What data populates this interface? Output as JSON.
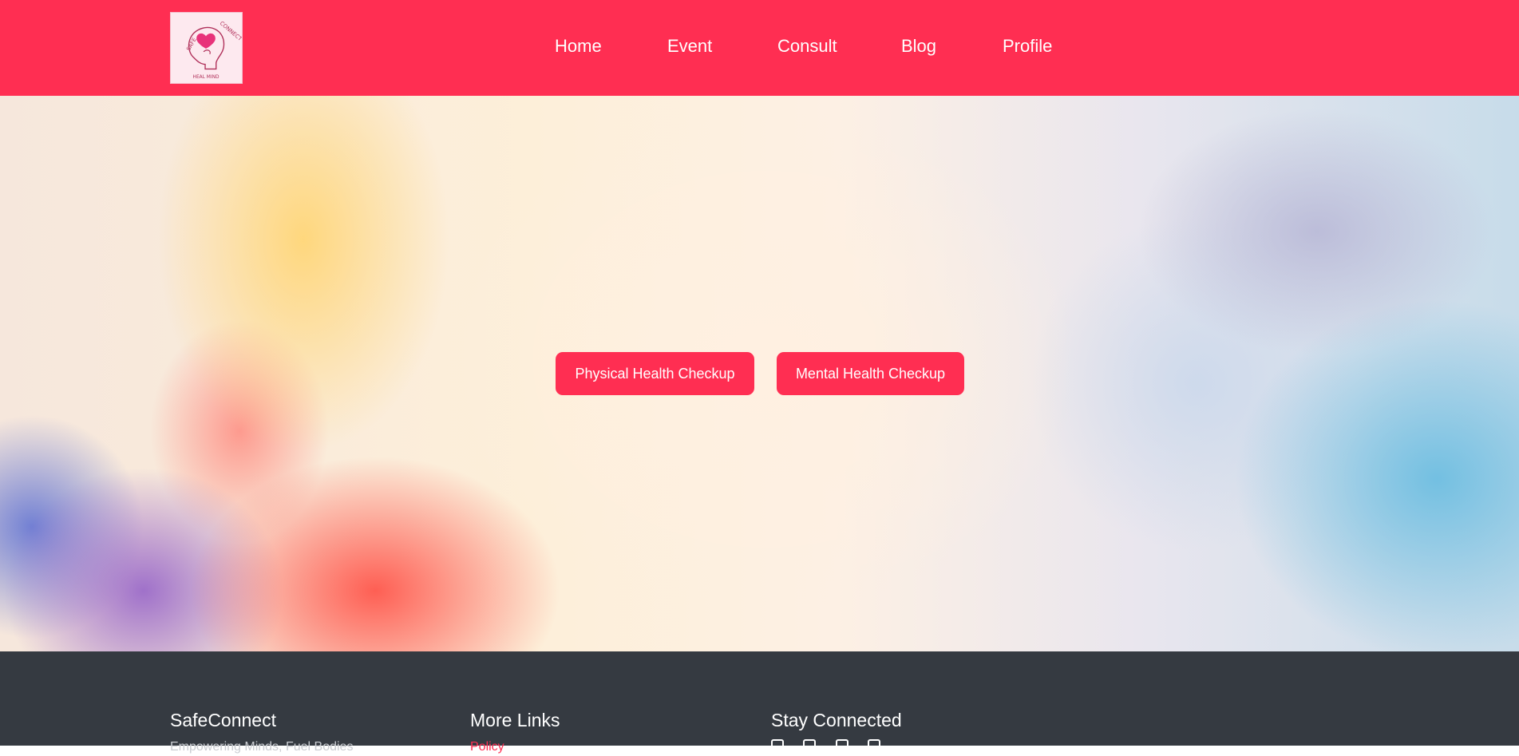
{
  "brand": {
    "logo_text_top": "SAFECONNECT",
    "logo_text_bottom": "HEAL MIND",
    "logo_icon": "heart-brain-logo"
  },
  "nav": {
    "items": [
      {
        "label": "Home"
      },
      {
        "label": "Event"
      },
      {
        "label": "Consult"
      },
      {
        "label": "Blog"
      },
      {
        "label": "Profile"
      }
    ]
  },
  "hero": {
    "buttons": [
      {
        "label": "Physical Health Checkup"
      },
      {
        "label": "Mental Health Checkup"
      }
    ]
  },
  "footer": {
    "columns": [
      {
        "heading": "SafeConnect",
        "sub": "Empowering Minds, Fuel Bodies"
      },
      {
        "heading": "More Links",
        "sub": "Policy"
      },
      {
        "heading": "Stay Connected",
        "social_icons": [
          "facebook-icon",
          "twitter-icon",
          "instagram-icon",
          "email-icon"
        ]
      }
    ]
  },
  "colors": {
    "brand": "#ff2e52",
    "footer_bg": "#353a41",
    "text_light": "#ffffff"
  }
}
